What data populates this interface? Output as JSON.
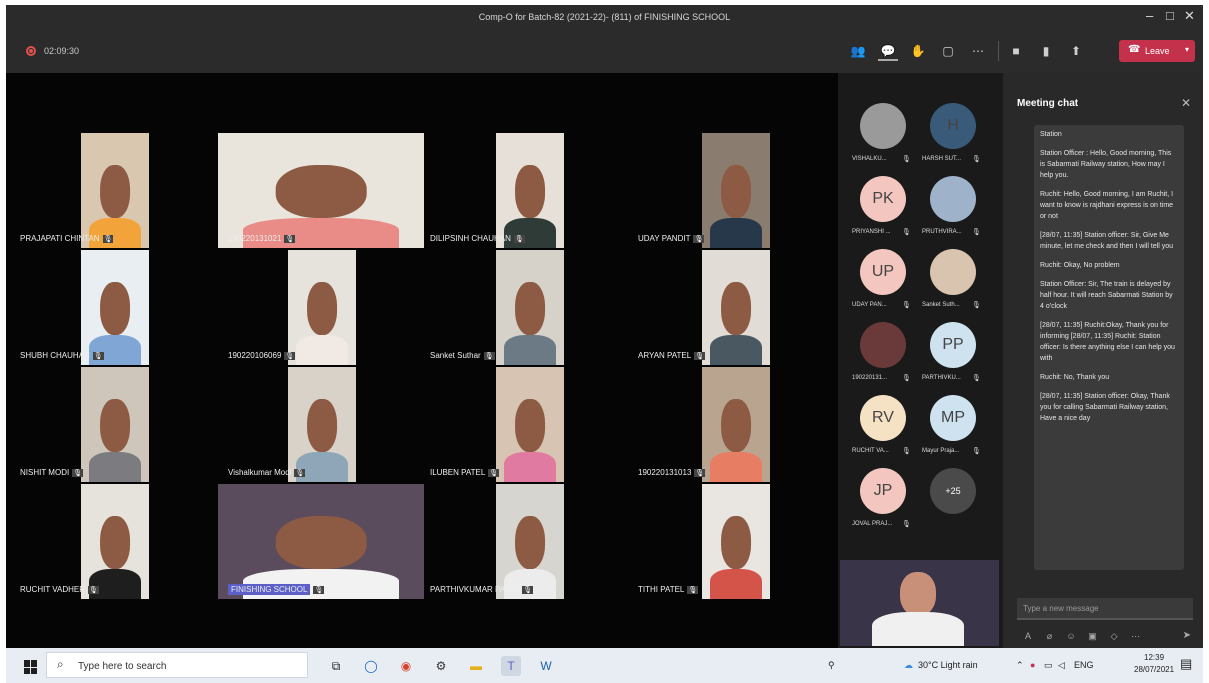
{
  "window": {
    "title": "Comp-O for Batch-82 (2021-22)- (811) of FINISHING SCHOOL",
    "controls": [
      "–",
      "□",
      "✕"
    ]
  },
  "toolbar": {
    "timer": "02:09:30",
    "leave_label": "Leave"
  },
  "participants": [
    {
      "name": "PRAJAPATI CHINTAN",
      "bg": "#d9c7b0",
      "shirt": "#f2a33a"
    },
    {
      "name": "190220131021",
      "bg": "#e9e4dc",
      "shirt": "#e98b86"
    },
    {
      "name": "DILIPSINH CHAUHAN",
      "bg": "#e7e0d8",
      "shirt": "#2f3b36"
    },
    {
      "name": "UDAY PANDIT",
      "bg": "#8a7d6f",
      "shirt": "#26384a"
    },
    {
      "name": "SHUBH CHAUHAN",
      "bg": "#e9eef2",
      "shirt": "#7fa6d4"
    },
    {
      "name": "190220106069",
      "bg": "#e6e2dc",
      "shirt": "#f0e9e4"
    },
    {
      "name": "Sanket Suthar",
      "bg": "#d6d1c9",
      "shirt": "#6c7a86"
    },
    {
      "name": "ARYAN PATEL",
      "bg": "#e1ddd6",
      "shirt": "#4a5862"
    },
    {
      "name": "NISHIT MODI",
      "bg": "#cfc6bb",
      "shirt": "#7b7b80"
    },
    {
      "name": "Vishalkumar Modi",
      "bg": "#d8d2c8",
      "shirt": "#8ea6b8"
    },
    {
      "name": "ILUBEN PATEL",
      "bg": "#d7c4b2",
      "shirt": "#e07aa0"
    },
    {
      "name": "190220131013",
      "bg": "#b9a58f",
      "shirt": "#e77e64"
    },
    {
      "name": "RUCHIT VADHER",
      "bg": "#e6e2dc",
      "shirt": "#1e1e1e"
    },
    {
      "name": "FINISHING SCHOOL",
      "bg": "#5a4c5c",
      "shirt": "#f2f2f2"
    },
    {
      "name": "PARTHIVKUMAR PATEL",
      "bg": "#d7d5cf",
      "shirt": "#ececec"
    },
    {
      "name": "TITHI PATEL",
      "bg": "#e9e6e1",
      "shirt": "#d4544a"
    }
  ],
  "roster": [
    {
      "initials": "",
      "name": "VISHALKU...",
      "color": "#9a9a9a"
    },
    {
      "initials": "H",
      "name": "HARSH SUT...",
      "color": "#3a5a7a"
    },
    {
      "initials": "PK",
      "name": "PRIYANSHI ...",
      "color": "#f3c7c0"
    },
    {
      "initials": "",
      "name": "PRUTHVIRA...",
      "color": "#9eb3c9"
    },
    {
      "initials": "UP",
      "name": "UDAY PAN...",
      "color": "#f3c7c0"
    },
    {
      "initials": "",
      "name": "Sanket Suth...",
      "color": "#d9c4b0"
    },
    {
      "initials": "",
      "name": "190220131...",
      "color": "#6a3a3a"
    },
    {
      "initials": "PP",
      "name": "PARTHIVKU...",
      "color": "#cfe2f0"
    },
    {
      "initials": "RV",
      "name": "RUCHIT VA...",
      "color": "#f5e2c5"
    },
    {
      "initials": "MP",
      "name": "Mayur Praja...",
      "color": "#cfe2f0"
    },
    {
      "initials": "JP",
      "name": "JOVAL PRAJ...",
      "color": "#f3c7c0"
    },
    {
      "initials": "+25",
      "name": "",
      "color": "#4a4a4a"
    }
  ],
  "chat": {
    "title": "Meeting chat",
    "input_placeholder": "Type a new message",
    "messages": [
      "Station",
      "Station Officer : Hello, Good morning, This is Sabarmati Railway station, How may I help you.",
      "Ruchit: Hello, Good morning, I am Ruchit, I want to know is rajdhani express is on time or not",
      "[28/07, 11:35] Station officer: Sir, Give Me minute, let me check and then I will tell you",
      "Ruchit: Okay, No problem",
      "Station Officer: Sir, The train is delayed by half hour. It will reach Sabarmati Station by 4 o'clock",
      "[28/07, 11:35] Ruchit:Okay, Thank you for informing [28/07, 11:35] Ruchit: Station officer: Is there anything else I can help you with",
      "Ruchit: No, Thank you",
      "[28/07, 11:35] Station officer: Okay, Thank you for calling Sabarmati Railway station, Have a nice day"
    ]
  },
  "taskbar": {
    "search_placeholder": "Type here to search",
    "weather": "30°C  Light rain",
    "lang": "ENG",
    "time": "12:39",
    "date": "28/07/2021"
  }
}
